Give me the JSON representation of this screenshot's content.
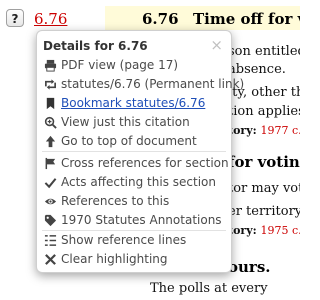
{
  "page": {
    "help_button": "?",
    "section_link": "6.76",
    "section_number": "6.76",
    "section_title": "Time off for voting.",
    "lines": [
      "son entitled t",
      "absence.",
      "lty, other tha",
      "tion applies t"
    ],
    "history_label": "tory:",
    "history_1": "1977 c. 3",
    "next_heading": "for voting.",
    "lines_2": [
      "tor may vote",
      "er territory v"
    ],
    "history_2": "1975 c. 8",
    "hours_heading": "ours.",
    "last_line": "The polls at every"
  },
  "popup": {
    "title": "Details for 6.76",
    "close": "×",
    "items": [
      {
        "icon": "printer-icon",
        "label": "PDF view (page 17)"
      },
      {
        "icon": "retweet-icon",
        "label": "statutes/6.76 (Permanent link)"
      },
      {
        "icon": "bookmark-icon",
        "label": " Bookmark statutes/6.76"
      },
      {
        "icon": "magnifier-plus-icon",
        "label": "View just this citation"
      },
      {
        "icon": "arrow-up-icon",
        "label": "Go to top of document"
      },
      {
        "icon": "flag-icon",
        "label": "Cross references for section"
      },
      {
        "icon": "check-icon",
        "label": "Acts affecting this section"
      },
      {
        "icon": "eye-icon",
        "label": "References to this"
      },
      {
        "icon": "tag-icon",
        "label": "1970 Statutes Annotations"
      },
      {
        "icon": "reference-lines-icon",
        "label": "Show reference lines"
      },
      {
        "icon": "x-mark-icon",
        "label": "Clear highlighting"
      }
    ]
  },
  "colors": {
    "link_red": "#cc0000",
    "active_blue": "#1f4fb8",
    "header_band": "#fffbd9",
    "menu_text": "#4a4a4a"
  }
}
